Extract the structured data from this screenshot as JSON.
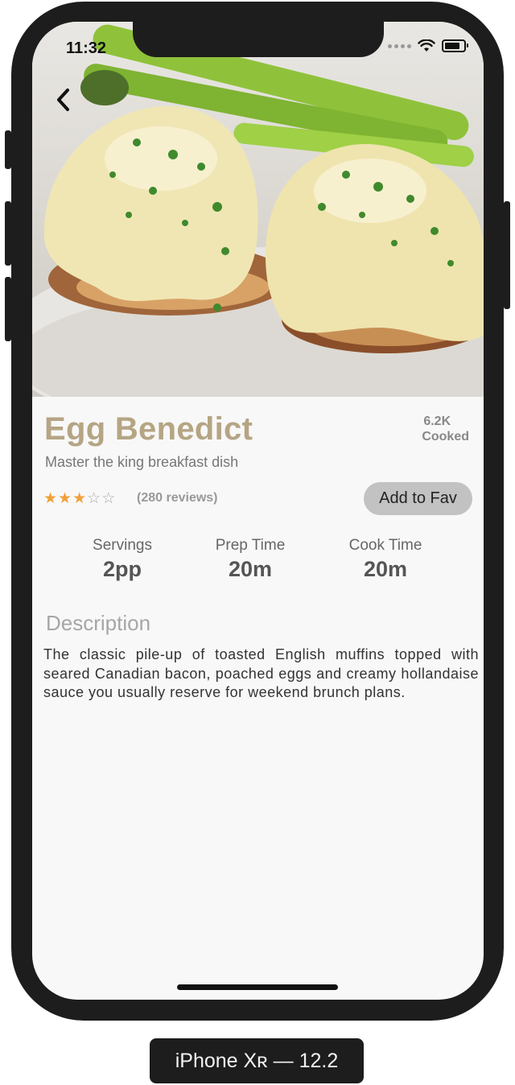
{
  "status_bar": {
    "time": "11:32"
  },
  "recipe": {
    "title": "Egg Benedict",
    "cooked_count": "6.2K",
    "cooked_label": "Cooked",
    "subtitle": "Master the king breakfast dish",
    "rating": {
      "value": 3,
      "max": 5
    },
    "reviews": "(280 reviews)",
    "fav_button": "Add to Fav",
    "stats": [
      {
        "label": "Servings",
        "value": "2pp"
      },
      {
        "label": "Prep Time",
        "value": "20m"
      },
      {
        "label": "Cook Time",
        "value": "20m"
      }
    ],
    "description_heading": "Description",
    "description": "The classic pile-up of toasted English muffins topped with seared Canadian bacon, poached eggs and creamy hollandaise sauce you usually reserve for weekend brunch plans."
  },
  "device_label": "iPhone Xʀ — 12.2",
  "icons": {
    "back": "chevron-left-icon",
    "wifi": "wifi-icon",
    "battery": "battery-icon",
    "star": "star-icon"
  },
  "colors": {
    "title": "#b5a584",
    "star_filled": "#f2a03a",
    "fav_button_bg": "#c2c2c2",
    "frame": "#1d1d1d"
  }
}
